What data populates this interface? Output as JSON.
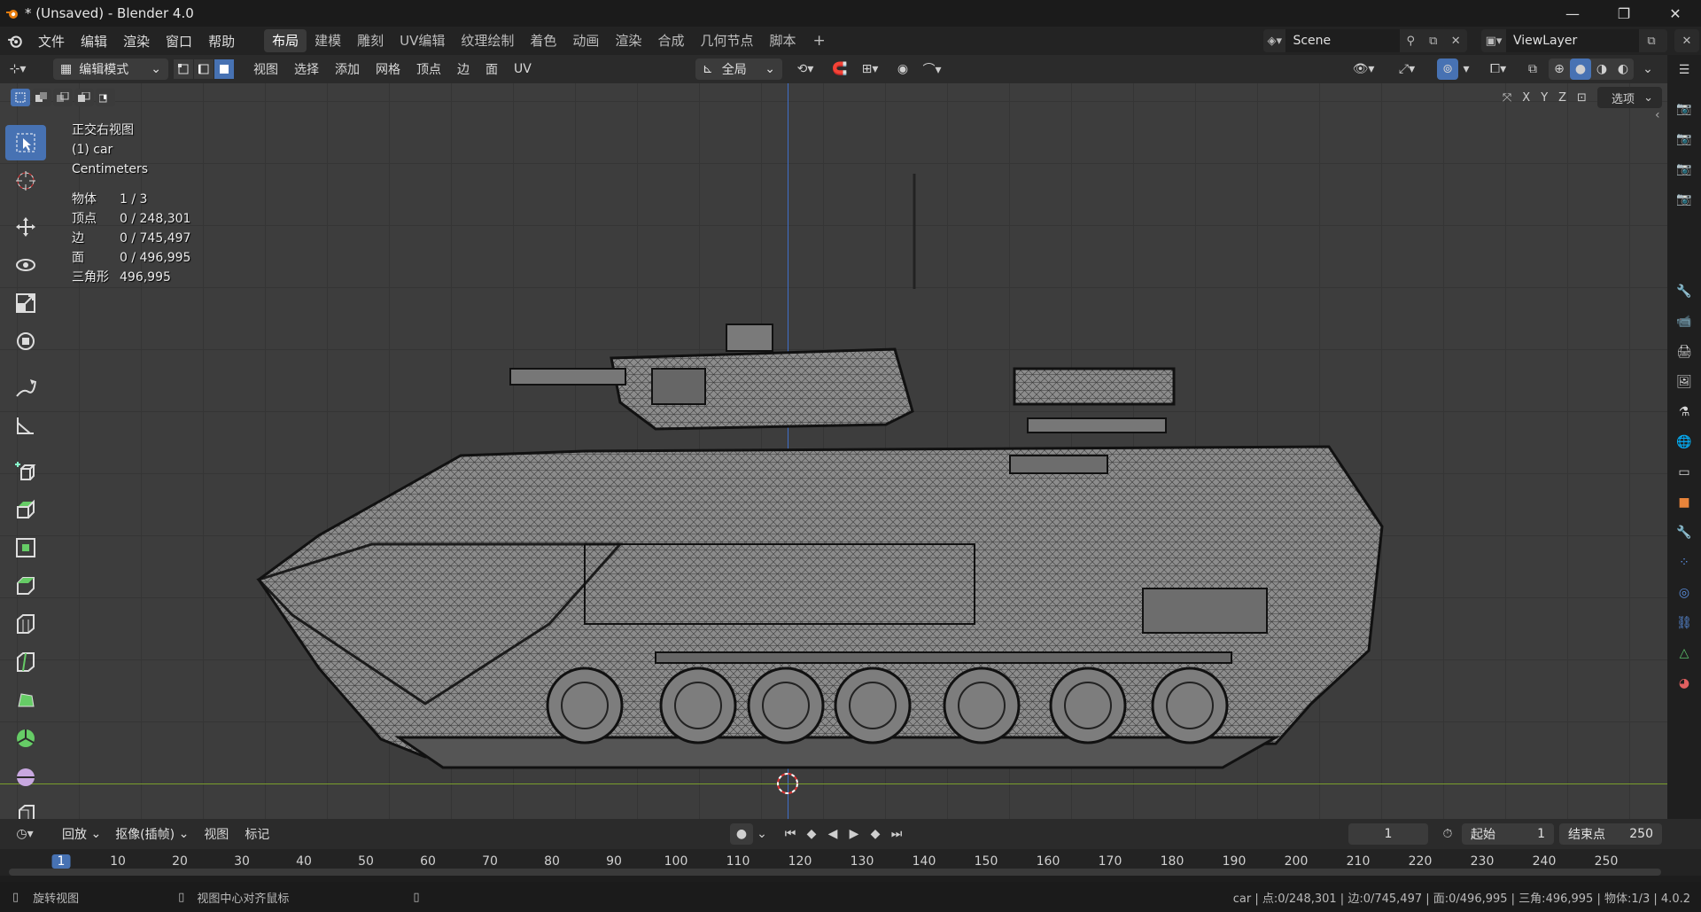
{
  "window": {
    "title": "* (Unsaved) - Blender 4.0",
    "minimize": "—",
    "maximize": "❐",
    "close": "✕"
  },
  "menubar": {
    "items": [
      "文件",
      "编辑",
      "渲染",
      "窗口",
      "帮助"
    ],
    "workspaces": [
      "布局",
      "建模",
      "雕刻",
      "UV编辑",
      "纹理绘制",
      "着色",
      "动画",
      "渲染",
      "合成",
      "几何节点",
      "脚本"
    ],
    "active_workspace": "布局",
    "add_workspace": "+",
    "scene": "Scene",
    "view_layer": "ViewLayer"
  },
  "viewport_header": {
    "mode": "编辑模式",
    "menus": [
      "视图",
      "选择",
      "添加",
      "网格",
      "顶点",
      "边",
      "面",
      "UV"
    ],
    "transform_orientation": "全局",
    "options": "选项",
    "axes": [
      "X",
      "Y",
      "Z"
    ]
  },
  "viewport": {
    "view_name": "正交右视图",
    "object_name": "(1) car",
    "units": "Centimeters",
    "stats": [
      {
        "label": "物体",
        "value": "1 / 3"
      },
      {
        "label": "顶点",
        "value": "0 / 248,301"
      },
      {
        "label": "边",
        "value": "0 / 745,497"
      },
      {
        "label": "面",
        "value": "0 / 496,995"
      },
      {
        "label": "三角形",
        "value": "496,995"
      }
    ]
  },
  "toolbar": {
    "tools": [
      "select-box",
      "cursor",
      "move",
      "rotate",
      "scale",
      "transform",
      "annotate",
      "measure",
      "add-cube",
      "extrude",
      "inset",
      "bevel",
      "loop-cut",
      "knife",
      "poly-build",
      "spin",
      "smooth",
      "shear"
    ]
  },
  "timeline": {
    "playback": "回放",
    "keying": "抠像(插帧)",
    "view": "视图",
    "marker": "标记",
    "current_frame": "1",
    "start_label": "起始",
    "start": "1",
    "end_label": "结束点",
    "end": "250",
    "ruler": [
      "1",
      "10",
      "20",
      "30",
      "40",
      "50",
      "60",
      "70",
      "80",
      "90",
      "100",
      "110",
      "120",
      "130",
      "140",
      "150",
      "160",
      "170",
      "180",
      "190",
      "200",
      "210",
      "220",
      "230",
      "240",
      "250"
    ]
  },
  "statusbar": {
    "left_action": "旋转视图",
    "mid_action": "视图中心对齐鼠标",
    "info": "car | 点:0/248,301 | 边:0/745,497 | 面:0/496,995 | 三角:496,995 | 物体:1/3 | 4.0.2"
  },
  "colors": {
    "accent": "#4772b3",
    "grid": "#3d3d3d",
    "x_axis": "#7a9d2c",
    "z_axis": "#3f6fc8"
  }
}
